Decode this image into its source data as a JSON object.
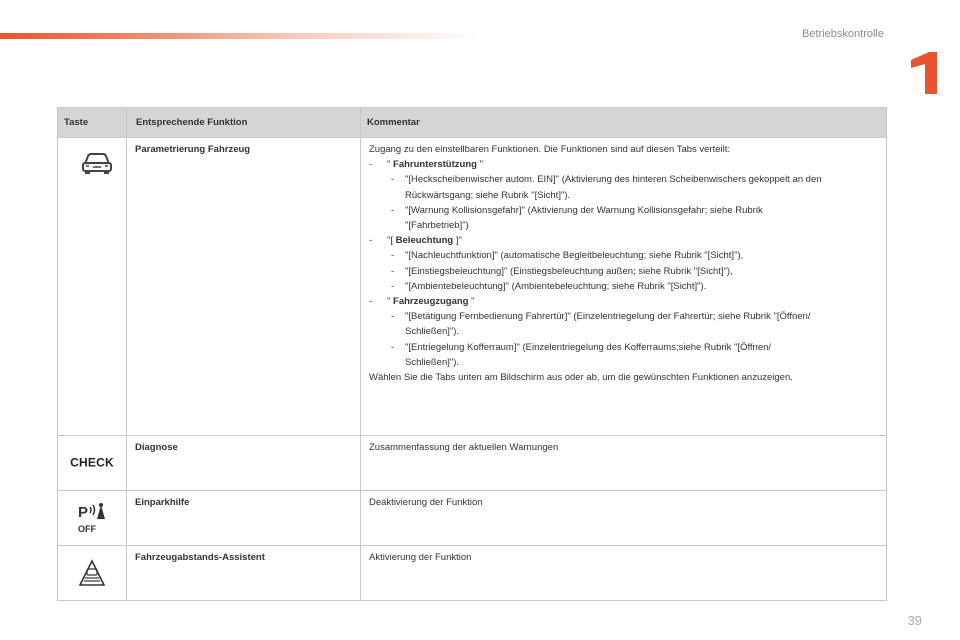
{
  "header": {
    "section_title": "Betriebskontrolle",
    "chapter_number": "1",
    "accent_color": "#e8542f"
  },
  "table": {
    "columns": [
      "Taste",
      "Entsprechende Funktion",
      "Kommentar"
    ],
    "rows": [
      {
        "icon": "car-front-icon",
        "function": "Parametrierung Fahrzeug",
        "lines": [
          {
            "level": 0,
            "dash": "",
            "text": "Zugang zu den einstellbaren Funktionen. Die Funktionen sind auf diesen Tabs verteilt:"
          },
          {
            "level": 1,
            "dash": "-",
            "pre": "\" ",
            "bold": "Fahrunterstützung",
            "post": " \""
          },
          {
            "level": 2,
            "dash": "-",
            "text": "\"[Heckscheibenwischer autom. EIN]\" (Aktivierung des hinteren Scheibenwischers gekoppelt an den"
          },
          {
            "level": 3,
            "dash": "",
            "text": "Rückwärtsgang; siehe Rubrik \"[Sicht]\")."
          },
          {
            "level": 2,
            "dash": "-",
            "text": "\"[Warnung Kollisionsgefahr]\" (Aktivierung der Warnung Kollisionsgefahr; siehe Rubrik"
          },
          {
            "level": 3,
            "dash": "",
            "text": "\"[Fahrbetrieb]\")"
          },
          {
            "level": 1,
            "dash": "-",
            "pre": "\"[ ",
            "bold": "Beleuchtung",
            "post": " ]\""
          },
          {
            "level": 2,
            "dash": "-",
            "text": "\"[Nachleuchtfunktion]\" (automatische Begleitbeleuchtung; siehe Rubrik \"[Sicht]\"),"
          },
          {
            "level": 2,
            "dash": "-",
            "text": "\"[Einstiegsbeleuchtung]\" (Einstiegsbeleuchtung außen; siehe Rubrik \"[Sicht]\"),"
          },
          {
            "level": 2,
            "dash": "-",
            "text": "\"[Ambientebeleuchtung]\" (Ambientebeleuchtung; siehe Rubrik \"[Sicht]\")."
          },
          {
            "level": 1,
            "dash": "-",
            "pre": "\" ",
            "bold": "Fahrzeugzugang",
            "post": " \""
          },
          {
            "level": 2,
            "dash": "-",
            "text": "\"[Betätigung Fernbedienung Fahrertür]\" (Einzelentriegelung der Fahrertür; siehe Rubrik \"[Öffnen/"
          },
          {
            "level": 3,
            "dash": "",
            "text": "Schließen]\")."
          },
          {
            "level": 2,
            "dash": "-",
            "text": "\"[Entriegelung Kofferraum]\" (Einzelentriegelung des Kofferraums;siehe Rubrik \"[Öffnen/"
          },
          {
            "level": 3,
            "dash": "",
            "text": "Schließen]\")."
          },
          {
            "level": 0,
            "dash": "",
            "text": "Wählen Sie die Tabs unten am Bildschirm aus oder ab, um die gewünschten Funktionen anzuzeigen."
          }
        ]
      },
      {
        "icon": "check-icon",
        "icon_text": "CHECK",
        "function": "Diagnose",
        "lines": [
          {
            "level": 0,
            "dash": "",
            "text": "Zusammenfassung der aktuellen Warnungen"
          }
        ]
      },
      {
        "icon": "parking-sensor-off-icon",
        "icon_text": "OFF",
        "function": "Einparkhilfe",
        "lines": [
          {
            "level": 0,
            "dash": "",
            "text": "Deaktivierung der Funktion"
          }
        ]
      },
      {
        "icon": "distance-assist-icon",
        "function": "Fahrzeugabstands-Assistent",
        "lines": [
          {
            "level": 0,
            "dash": "",
            "text": "Aktivierung der Funktion"
          }
        ]
      }
    ]
  },
  "footer": {
    "page_number": "39"
  }
}
